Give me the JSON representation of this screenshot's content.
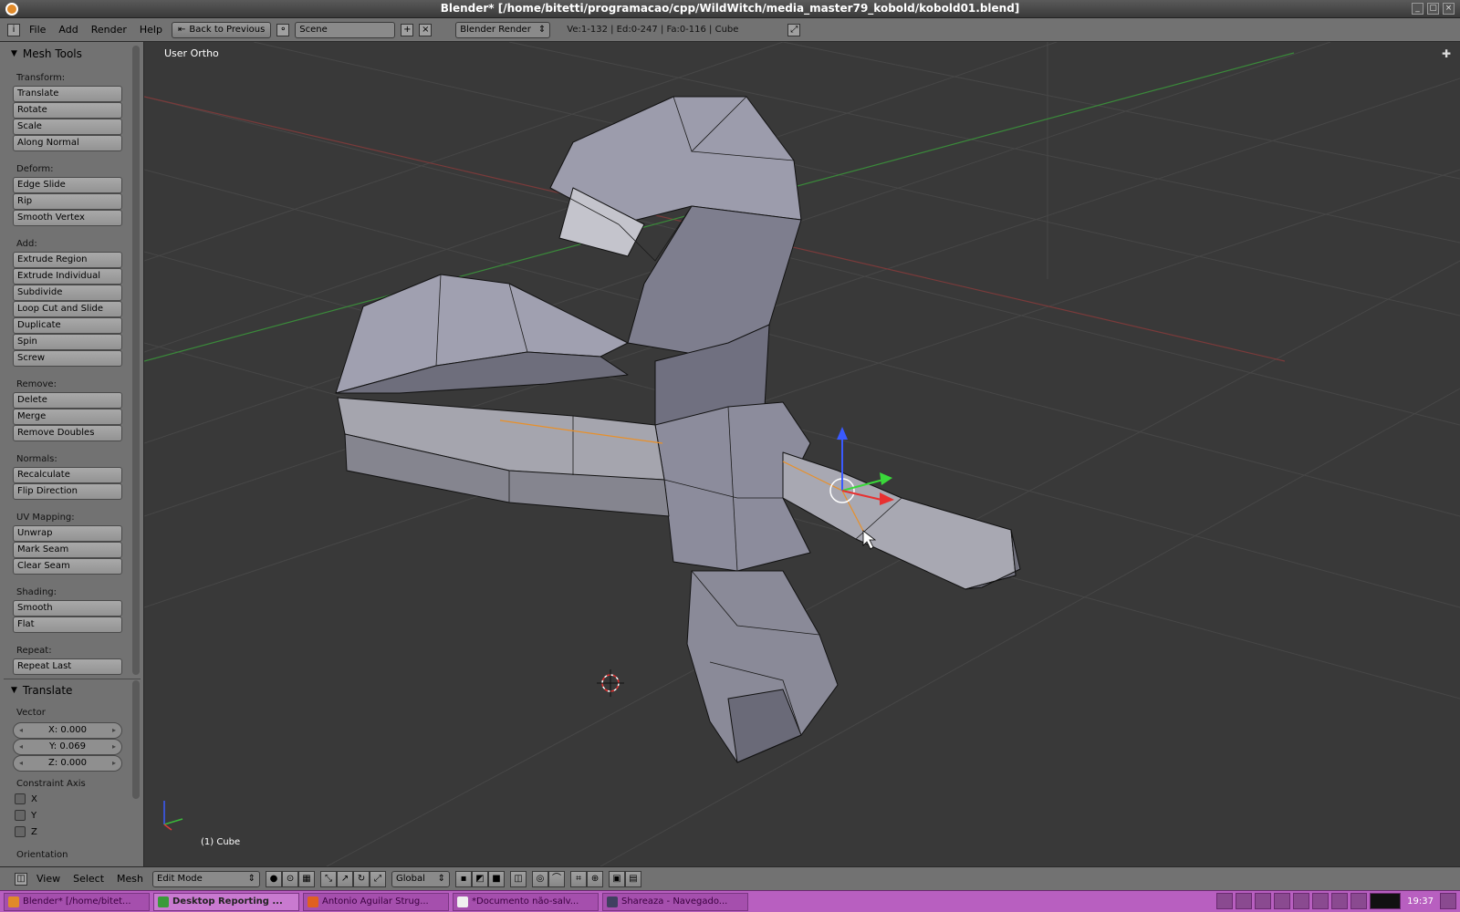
{
  "window": {
    "title": "Blender* [/home/bitetti/programacao/cpp/WildWitch/media_master79_kobold/kobold01.blend]",
    "controls": [
      "_",
      "▢",
      "×"
    ]
  },
  "topbar": {
    "menus": [
      "File",
      "Add",
      "Render",
      "Help"
    ],
    "back_button": "Back to Previous",
    "scene_name": "Scene",
    "render_engine": "Blender Render",
    "stats": "Ve:1-132 | Ed:0-247 | Fa:0-116 | Cube"
  },
  "toolshelf": {
    "title": "Mesh Tools",
    "sections": {
      "transform": "Transform:",
      "deform": "Deform:",
      "add": "Add:",
      "remove": "Remove:",
      "normals": "Normals:",
      "uv": "UV Mapping:",
      "shading": "Shading:",
      "repeat": "Repeat:"
    },
    "buttons": {
      "translate": "Translate",
      "rotate": "Rotate",
      "scale": "Scale",
      "along_normal": "Along Normal",
      "edge_slide": "Edge Slide",
      "rip": "Rip",
      "smooth_vertex": "Smooth Vertex",
      "extrude_region": "Extrude Region",
      "extrude_individual": "Extrude Individual",
      "subdivide": "Subdivide",
      "loop_cut": "Loop Cut and Slide",
      "duplicate": "Duplicate",
      "spin": "Spin",
      "screw": "Screw",
      "delete": "Delete",
      "merge": "Merge",
      "remove_doubles": "Remove Doubles",
      "recalculate": "Recalculate",
      "flip_direction": "Flip Direction",
      "unwrap": "Unwrap",
      "mark_seam": "Mark Seam",
      "clear_seam": "Clear Seam",
      "smooth": "Smooth",
      "flat": "Flat",
      "repeat_last": "Repeat Last"
    }
  },
  "operator": {
    "title": "Translate",
    "vector_label": "Vector",
    "x": "X: 0.000",
    "y": "Y: 0.069",
    "z": "Z: 0.000",
    "constraint_label": "Constraint Axis",
    "axis_x": "X",
    "axis_y": "Y",
    "axis_z": "Z",
    "orientation_label": "Orientation"
  },
  "viewport": {
    "view_name": "User Ortho",
    "object_label": "(1) Cube"
  },
  "bottombar": {
    "menus": [
      "View",
      "Select",
      "Mesh"
    ],
    "mode": "Edit Mode",
    "orientation": "Global"
  },
  "taskbar": {
    "tasks": [
      {
        "label": "Blender* [/home/bitet...",
        "color": "#e08a2a",
        "active": false
      },
      {
        "label": "Desktop Reporting ...",
        "color": "#3a9a3a",
        "active": true
      },
      {
        "label": "Antonio Aguilar Strug...",
        "color": "#e06020",
        "active": false
      },
      {
        "label": "*Documento não-salv...",
        "color": "#f0f0f0",
        "active": false
      },
      {
        "label": "Shareaza - Navegado...",
        "color": "#404060",
        "active": false
      }
    ],
    "clock": "19:37"
  },
  "colors": {
    "viewport_bg": "#393939",
    "panel_bg": "#727272",
    "mesh_face": "#8e8e9c",
    "x_axis": "#c83a3a",
    "y_axis": "#3ab83a",
    "taskbar": "#b85fc0"
  }
}
